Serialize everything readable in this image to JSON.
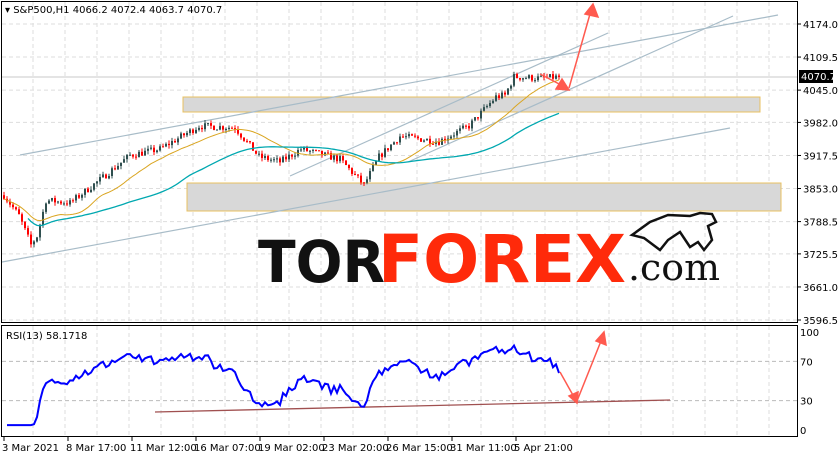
{
  "header": {
    "symbol": "S&P500,H1",
    "ohlc": "4066.2 4072.4 4063.7 4070.7"
  },
  "current_price_label": "4070.7",
  "rsi": {
    "label": "RSI(13) 58.1718",
    "levels": [
      100,
      70,
      30,
      0
    ]
  },
  "logo": {
    "part1": "TOR",
    "part2": "FOREX",
    "part3": ".com"
  },
  "colors": {
    "bull": "#2f4f4f",
    "bear": "#ff0000",
    "ma_fast": "#daa520",
    "ma_slow": "#00a8b0",
    "rsi": "#0000ff",
    "arrow": "#ff5a4f",
    "channel": "#a8bcc8",
    "support": "#a05050"
  },
  "chart_data": {
    "type": "candlestick",
    "title": "S&P500,H1",
    "price_ticks": [
      "4174.0",
      "4109.5",
      "4045.0",
      "3982.0",
      "3917.5",
      "3853.0",
      "3788.5",
      "3725.5",
      "3661.0",
      "3596.5"
    ],
    "price_tick_values": [
      4174.0,
      4109.5,
      4045.0,
      3982.0,
      3917.5,
      3853.0,
      3788.5,
      3725.5,
      3661.0,
      3596.5
    ],
    "ylim": [
      3596.5,
      4174.0
    ],
    "time_ticks": [
      "3 Mar 2021",
      "8 Mar 17:00",
      "11 Mar 12:00",
      "16 Mar 07:00",
      "19 Mar 02:00",
      "23 Mar 20:00",
      "26 Mar 15:00",
      "31 Mar 11:00",
      "5 Apr 21:00"
    ],
    "price_path": [
      [
        0,
        3840
      ],
      [
        5,
        3800
      ],
      [
        9,
        3743
      ],
      [
        11,
        3760
      ],
      [
        14,
        3830
      ],
      [
        22,
        3825
      ],
      [
        32,
        3870
      ],
      [
        42,
        3918
      ],
      [
        52,
        3930
      ],
      [
        65,
        3975
      ],
      [
        77,
        3972
      ],
      [
        85,
        3915
      ],
      [
        92,
        3905
      ],
      [
        99,
        3930
      ],
      [
        112,
        3910
      ],
      [
        120,
        3860
      ],
      [
        125,
        3915
      ],
      [
        132,
        3955
      ],
      [
        145,
        3945
      ],
      [
        155,
        3975
      ],
      [
        164,
        4032
      ],
      [
        167,
        4035
      ],
      [
        170,
        4071
      ],
      [
        179,
        4068
      ],
      [
        185,
        4070.7
      ]
    ],
    "last_close": 4070.7,
    "ma_periods": [
      20,
      50
    ],
    "rsi_period": 13,
    "rsi_last": 58.1718,
    "zones": [
      [
        4028,
        4057
      ],
      [
        3810,
        3866
      ]
    ]
  }
}
